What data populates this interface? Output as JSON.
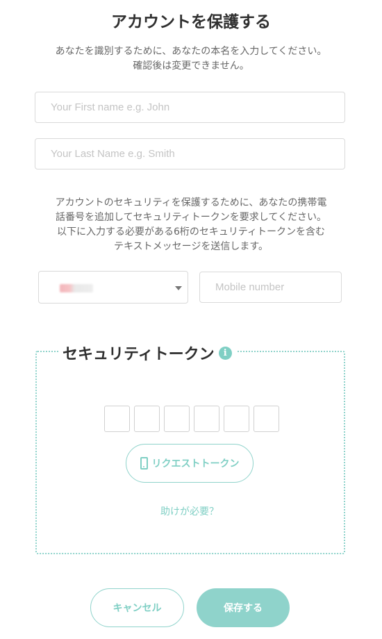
{
  "header": {
    "title": "アカウントを保護する"
  },
  "intro": {
    "line1": "あなたを識別するために、あなたの本名を入力してください。",
    "line2": "確認後は変更できません。"
  },
  "name_fields": {
    "first_name": {
      "value": "",
      "placeholder": "Your First name e.g. John"
    },
    "last_name": {
      "value": "",
      "placeholder": "Your Last Name e.g. Smith"
    }
  },
  "security_text": {
    "line1": "アカウントのセキュリティを保護するために、あなたの携帯電",
    "line2": "話番号を追加してセキュリティトークンを要求してください。",
    "line3": "以下に入力する必要がある6桁のセキュリティトークンを含む",
    "line4": "テキストメッセージを送信します。"
  },
  "phone": {
    "country_selected": "",
    "mobile": {
      "value": "",
      "placeholder": "Mobile number"
    }
  },
  "token": {
    "legend": "セキュリティトークン",
    "info_icon": "info-icon",
    "digit_count": 6,
    "request_button_label": "リクエストトークン",
    "request_button_icon": "phone-icon",
    "help_link": "助けが必要？"
  },
  "actions": {
    "cancel_label": "キャンセル",
    "save_label": "保存する"
  },
  "colors": {
    "accent": "#8fd3cb",
    "accent_text": "#7fcfc4",
    "title": "#2f2f2f",
    "body_text": "#666666",
    "border": "#d9d9d9"
  }
}
